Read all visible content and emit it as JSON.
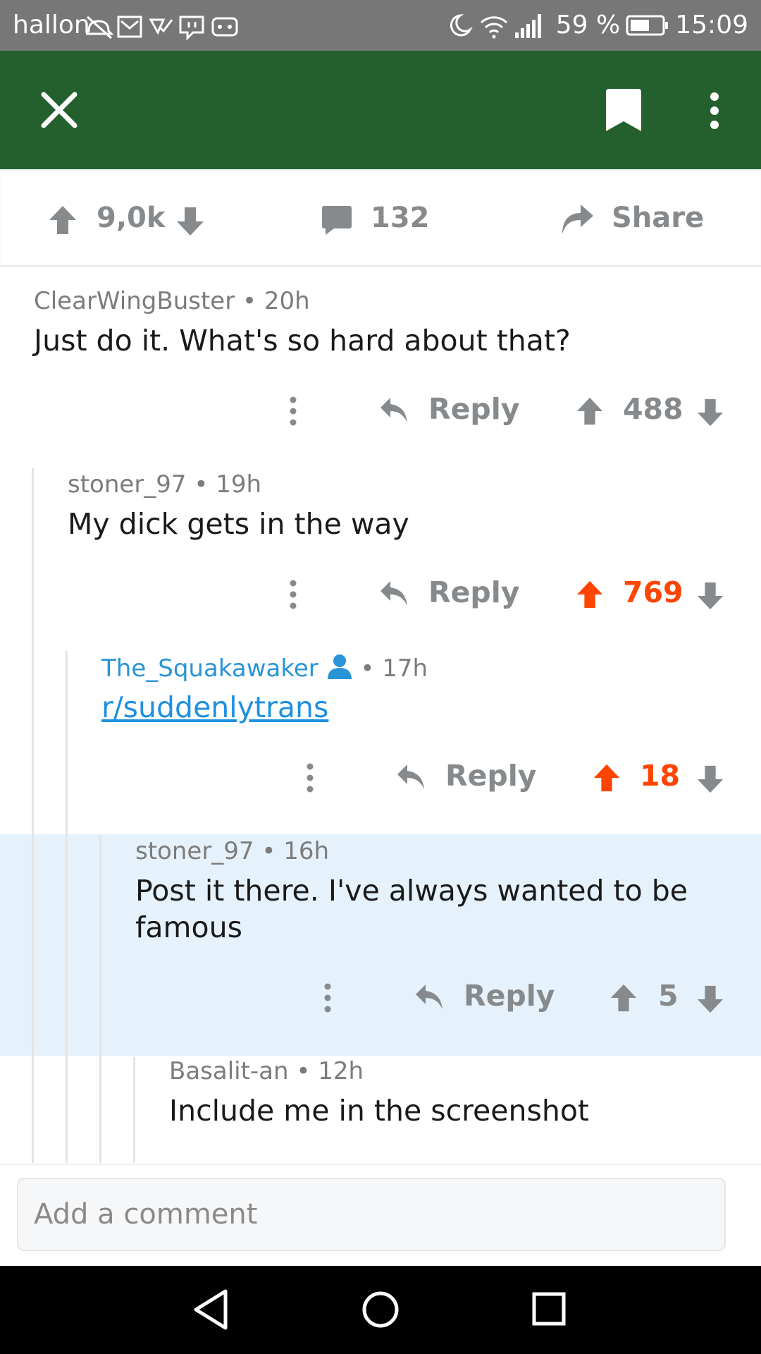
{
  "status_bar": {
    "carrier": "hallon",
    "battery": "59 %",
    "time": "15:09"
  },
  "app_bar": {
    "close_icon": "close-icon",
    "bookmark_icon": "bookmark-icon",
    "more_icon": "more-vertical-icon"
  },
  "post_actions": {
    "score": "9,0k",
    "comment_count": "132",
    "share_label": "Share"
  },
  "comments": [
    {
      "author": "ClearWingBuster",
      "separator": "•",
      "age": "20h",
      "body": "Just do it. What's so hard about that?",
      "reply_label": "Reply",
      "score": "488",
      "upvoted": false
    },
    {
      "author": "stoner_97",
      "separator": "•",
      "age": "19h",
      "body": "My dick gets in the way",
      "reply_label": "Reply",
      "score": "769",
      "upvoted": true
    },
    {
      "author": "The_Squakawaker",
      "separator": "•",
      "age": "17h",
      "body": "r/suddenlytrans",
      "reply_label": "Reply",
      "score": "18",
      "upvoted": true
    },
    {
      "author": "stoner_97",
      "separator": "•",
      "age": "16h",
      "body_line1": "Post it there. I've always wanted to be",
      "body_line2": "famous",
      "reply_label": "Reply",
      "score": "5",
      "upvoted": false
    },
    {
      "author": "Basalit-an",
      "separator": "•",
      "age": "12h",
      "body": "Include me in the screenshot"
    }
  ],
  "composer": {
    "placeholder": "Add a comment"
  },
  "colors": {
    "app_bar": "#23602e",
    "upvote": "#ff4500",
    "link": "#1e90e0",
    "highlight": "#e6f2fb"
  }
}
